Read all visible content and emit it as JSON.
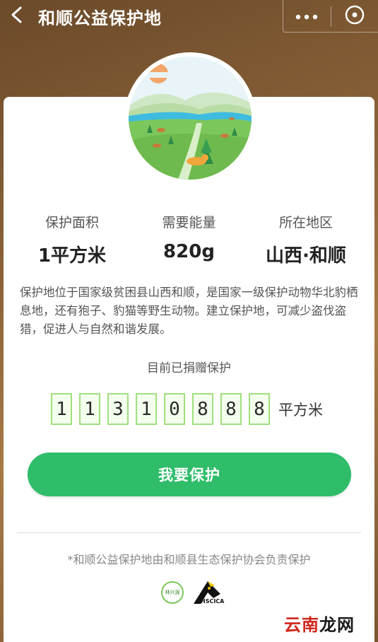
{
  "header": {
    "title": "和顺公益保护地",
    "icons": {
      "back": "chevron-left-icon",
      "more": "more-dots-icon",
      "close": "close-circle-icon"
    }
  },
  "stats": [
    {
      "label": "保护面积",
      "value": "1平方米"
    },
    {
      "label": "需要能量",
      "value": "820g"
    },
    {
      "label": "所在地区",
      "value": "山西·和顺"
    }
  ],
  "description": "保护地位于国家级贫困县山西和顺，是国家一级保护动物华北豹栖息地，还有狍子、豹猫等野生动物。建立保护地，可减少盗伐盗猎，促进人与自然和谐发展。",
  "protected": {
    "label": "目前已捐赠保护",
    "digits": [
      "1",
      "1",
      "3",
      "1",
      "0",
      "8",
      "8",
      "8"
    ],
    "unit": "平方米"
  },
  "cta": {
    "label": "我要保护"
  },
  "footer": {
    "note": "*和顺公益保护地由和顺县生态保护协会负责保护",
    "logo_left_text": "林兴源",
    "logo_right_text": "HSCICA"
  },
  "watermark": {
    "part1": "云南",
    "part2": "龙网"
  },
  "colors": {
    "accent": "#2fbd6a",
    "digit_border": "#9fe07e",
    "watermark_red": "#d0261c"
  }
}
